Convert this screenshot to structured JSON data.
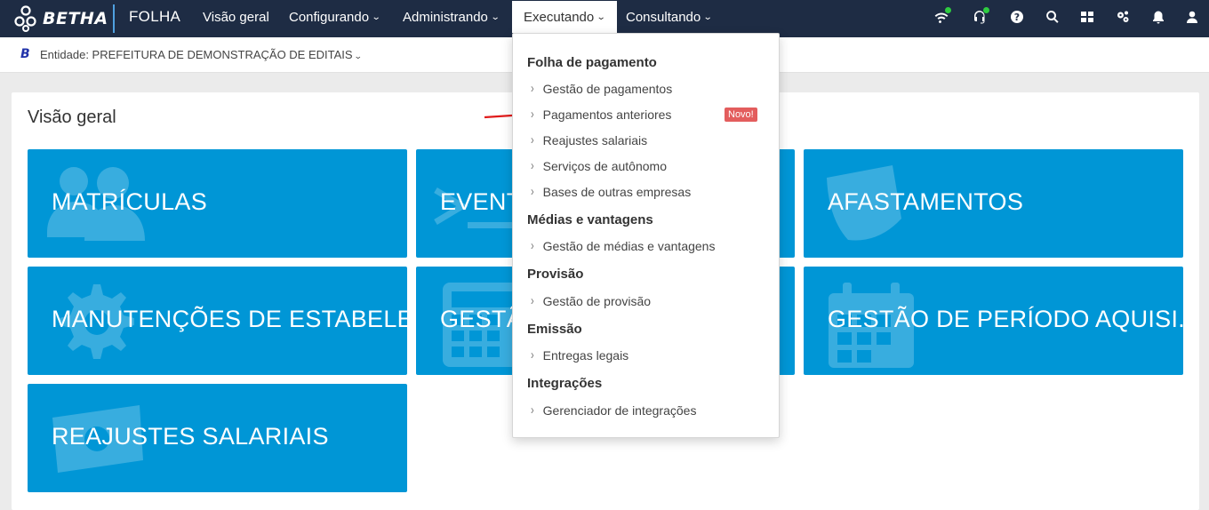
{
  "topbar": {
    "logo_text": "BETHA",
    "product": "FOLHA",
    "nav": [
      {
        "label": "Visão geral",
        "has_caret": false
      },
      {
        "label": "Configurando",
        "has_caret": true
      },
      {
        "label": "Administrando",
        "has_caret": true
      },
      {
        "label": "Executando",
        "has_caret": true,
        "active": true
      },
      {
        "label": "Consultando",
        "has_caret": true
      }
    ],
    "icons": [
      "wifi-icon",
      "headset-icon",
      "help-icon",
      "search-icon",
      "apps-icon",
      "settings-icon",
      "bell-icon",
      "user-icon"
    ]
  },
  "entity": {
    "badge": "B",
    "label": "Entidade: PREFEITURA DE DEMONSTRAÇÃO DE EDITAIS",
    "caret": "⌄"
  },
  "main": {
    "title": "Visão geral",
    "tiles": [
      {
        "label": "MATRÍCULAS",
        "icon": "users-icon"
      },
      {
        "label": "EVENTOS",
        "icon": "terminal-icon"
      },
      {
        "label": "AFASTAMENTOS",
        "icon": "shield-icon"
      },
      {
        "label": "MANUTENÇÕES DE ESTABELE...",
        "icon": "gear-icon"
      },
      {
        "label": "GESTÃO",
        "icon": "calculator-icon"
      },
      {
        "label": "GESTÃO DE PERÍODO AQUISI...",
        "icon": "calendar-icon"
      },
      {
        "label": "REAJUSTES SALARIAIS",
        "icon": "money-icon"
      }
    ],
    "tile_color": "#0096d6"
  },
  "menu": {
    "groups": [
      {
        "title": "Folha de pagamento",
        "items": [
          "Gestão de pagamentos",
          "Pagamentos anteriores",
          "Reajustes salariais",
          "Serviços de autônomo",
          "Bases de outras empresas"
        ]
      },
      {
        "title": "Médias e vantagens",
        "items": [
          "Gestão de médias e vantagens"
        ]
      },
      {
        "title": "Provisão",
        "items": [
          "Gestão de provisão"
        ]
      },
      {
        "title": "Emissão",
        "items": [
          "Entregas legais"
        ]
      },
      {
        "title": "Integrações",
        "items": [
          "Gerenciador de integrações"
        ]
      }
    ],
    "new_badge": "Novo!",
    "item_marker": "›"
  },
  "colors": {
    "topbar": "#1e2c44",
    "accent": "#4fa1e0",
    "badge": "#e35d5d",
    "status_dot": "#2ecc40"
  }
}
